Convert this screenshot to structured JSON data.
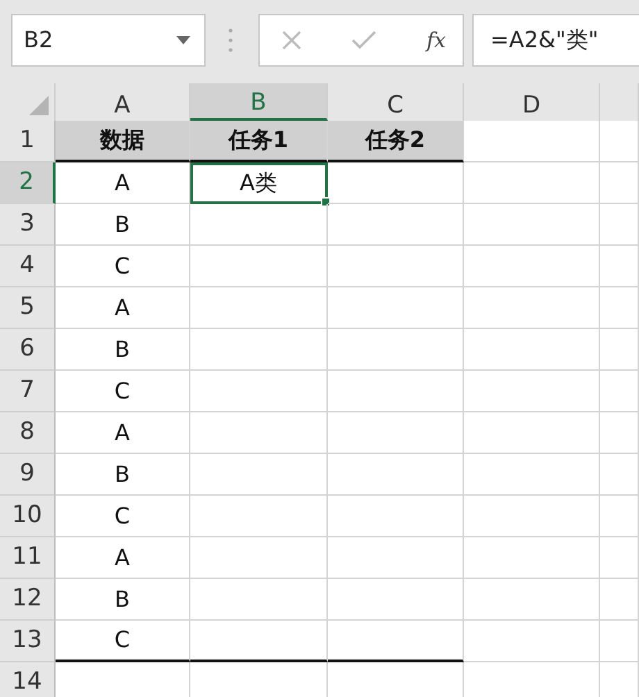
{
  "name_box": {
    "value": "B2"
  },
  "formula_bar": {
    "fx": "fx",
    "value": "=A2&\"类\""
  },
  "columns": [
    {
      "label": "A",
      "selected": false
    },
    {
      "label": "B",
      "selected": true
    },
    {
      "label": "C",
      "selected": false
    },
    {
      "label": "D",
      "selected": false
    },
    {
      "selected": false
    }
  ],
  "rows": [
    {
      "number": "1",
      "selected": false,
      "kind": "header",
      "border_below": true,
      "cells": [
        {
          "text": "数据",
          "selected": false
        },
        {
          "text": "任务1",
          "selected": false
        },
        {
          "text": "任务2",
          "selected": false
        },
        {
          "selected": false
        },
        {
          "selected": false
        }
      ]
    },
    {
      "number": "2",
      "selected": true,
      "kind": "data",
      "border_below": false,
      "cells": [
        {
          "text": "A",
          "selected": false
        },
        {
          "text": "A类",
          "selected": true
        },
        {
          "selected": false
        },
        {
          "selected": false
        },
        {
          "selected": false
        }
      ]
    },
    {
      "number": "3",
      "selected": false,
      "kind": "data",
      "border_below": false,
      "cells": [
        {
          "text": "B",
          "selected": false
        },
        {
          "selected": false
        },
        {
          "selected": false
        },
        {
          "selected": false
        },
        {
          "selected": false
        }
      ]
    },
    {
      "number": "4",
      "selected": false,
      "kind": "data",
      "border_below": false,
      "cells": [
        {
          "text": "C",
          "selected": false
        },
        {
          "selected": false
        },
        {
          "selected": false
        },
        {
          "selected": false
        },
        {
          "selected": false
        }
      ]
    },
    {
      "number": "5",
      "selected": false,
      "kind": "data",
      "border_below": false,
      "cells": [
        {
          "text": "A",
          "selected": false
        },
        {
          "selected": false
        },
        {
          "selected": false
        },
        {
          "selected": false
        },
        {
          "selected": false
        }
      ]
    },
    {
      "number": "6",
      "selected": false,
      "kind": "data",
      "border_below": false,
      "cells": [
        {
          "text": "B",
          "selected": false
        },
        {
          "selected": false
        },
        {
          "selected": false
        },
        {
          "selected": false
        },
        {
          "selected": false
        }
      ]
    },
    {
      "number": "7",
      "selected": false,
      "kind": "data",
      "border_below": false,
      "cells": [
        {
          "text": "C",
          "selected": false
        },
        {
          "selected": false
        },
        {
          "selected": false
        },
        {
          "selected": false
        },
        {
          "selected": false
        }
      ]
    },
    {
      "number": "8",
      "selected": false,
      "kind": "data",
      "border_below": false,
      "cells": [
        {
          "text": "A",
          "selected": false
        },
        {
          "selected": false
        },
        {
          "selected": false
        },
        {
          "selected": false
        },
        {
          "selected": false
        }
      ]
    },
    {
      "number": "9",
      "selected": false,
      "kind": "data",
      "border_below": false,
      "cells": [
        {
          "text": "B",
          "selected": false
        },
        {
          "selected": false
        },
        {
          "selected": false
        },
        {
          "selected": false
        },
        {
          "selected": false
        }
      ]
    },
    {
      "number": "10",
      "selected": false,
      "kind": "data",
      "border_below": false,
      "cells": [
        {
          "text": "C",
          "selected": false
        },
        {
          "selected": false
        },
        {
          "selected": false
        },
        {
          "selected": false
        },
        {
          "selected": false
        }
      ]
    },
    {
      "number": "11",
      "selected": false,
      "kind": "data",
      "border_below": false,
      "cells": [
        {
          "text": "A",
          "selected": false
        },
        {
          "selected": false
        },
        {
          "selected": false
        },
        {
          "selected": false
        },
        {
          "selected": false
        }
      ]
    },
    {
      "number": "12",
      "selected": false,
      "kind": "data",
      "border_below": false,
      "cells": [
        {
          "text": "B",
          "selected": false
        },
        {
          "selected": false
        },
        {
          "selected": false
        },
        {
          "selected": false
        },
        {
          "selected": false
        }
      ]
    },
    {
      "number": "13",
      "selected": false,
      "kind": "data",
      "border_below": true,
      "cells": [
        {
          "text": "C",
          "selected": false
        },
        {
          "selected": false
        },
        {
          "selected": false
        },
        {
          "selected": false
        },
        {
          "selected": false
        }
      ]
    },
    {
      "number": "14",
      "selected": false,
      "kind": "data",
      "cells": [
        {
          "selected": false
        },
        {
          "selected": false
        },
        {
          "selected": false
        },
        {
          "selected": false
        },
        {
          "selected": false
        }
      ]
    }
  ]
}
